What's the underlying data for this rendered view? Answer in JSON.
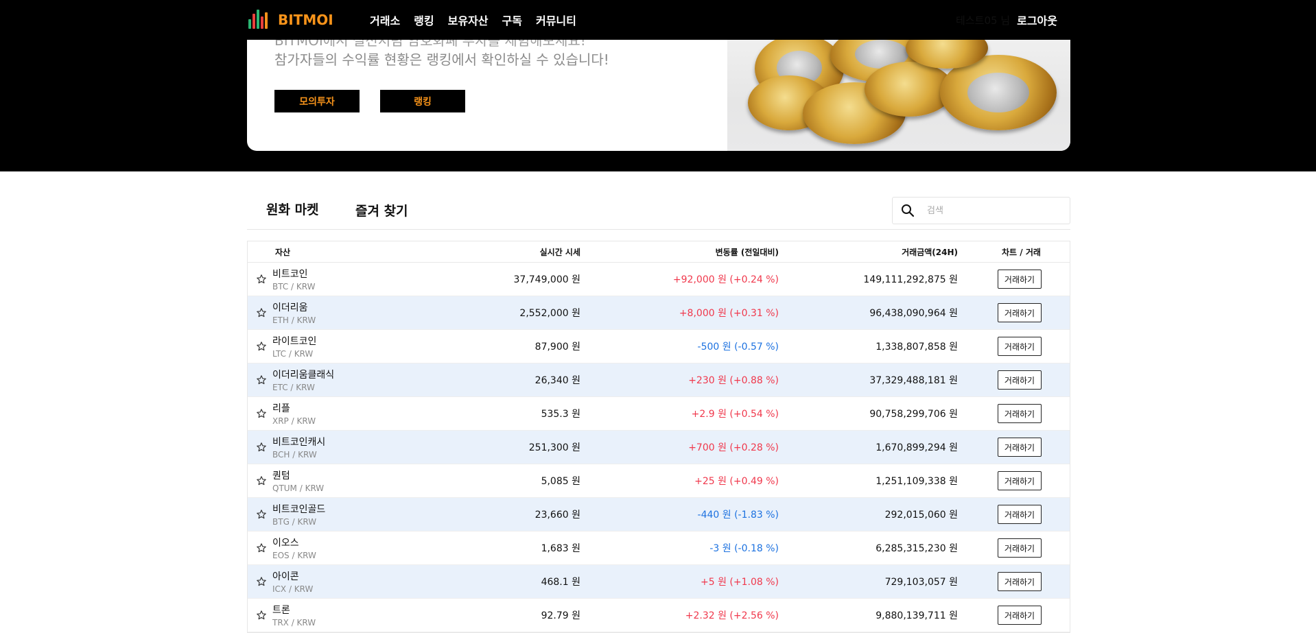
{
  "nav": {
    "logo_text": "BITMOI",
    "menu": [
      "거래소",
      "랭킹",
      "보유자산",
      "구독",
      "커뮤니티"
    ],
    "user_name": "테스트05 님",
    "logout_label": "로그아웃"
  },
  "hero": {
    "line1": "BITMOI에서 실전처럼 암호화폐 투자를 체험해보세요!",
    "line2": "참가자들의 수익률 현황은 랭킹에서 확인하실 수 있습니다!",
    "btn_trade": "모의투자",
    "btn_ranking": "랭킹"
  },
  "market": {
    "tabs": [
      "원화 마켓",
      "즐겨 찾기"
    ],
    "search_placeholder": "검색",
    "headers": {
      "asset": "자산",
      "price": "실시간 시세",
      "change": "변동률 (전일대비)",
      "volume": "거래금액(24H)",
      "action": "차트 / 거래"
    },
    "trade_label": "거래하기",
    "rows": [
      {
        "name": "비트코인",
        "symbol": "BTC / KRW",
        "price": "37,749,000 원",
        "change": "+92,000 원 (+0.24 %)",
        "dir": "up",
        "volume": "149,111,292,875 원"
      },
      {
        "name": "이더리움",
        "symbol": "ETH / KRW",
        "price": "2,552,000 원",
        "change": "+8,000 원 (+0.31 %)",
        "dir": "up",
        "volume": "96,438,090,964 원"
      },
      {
        "name": "라이트코인",
        "symbol": "LTC / KRW",
        "price": "87,900 원",
        "change": "-500 원 (-0.57 %)",
        "dir": "down",
        "volume": "1,338,807,858 원"
      },
      {
        "name": "이더리움클래식",
        "symbol": "ETC / KRW",
        "price": "26,340 원",
        "change": "+230 원 (+0.88 %)",
        "dir": "up",
        "volume": "37,329,488,181 원"
      },
      {
        "name": "리플",
        "symbol": "XRP / KRW",
        "price": "535.3 원",
        "change": "+2.9 원 (+0.54 %)",
        "dir": "up",
        "volume": "90,758,299,706 원"
      },
      {
        "name": "비트코인캐시",
        "symbol": "BCH / KRW",
        "price": "251,300 원",
        "change": "+700 원 (+0.28 %)",
        "dir": "up",
        "volume": "1,670,899,294 원"
      },
      {
        "name": "퀀텀",
        "symbol": "QTUM / KRW",
        "price": "5,085 원",
        "change": "+25 원 (+0.49 %)",
        "dir": "up",
        "volume": "1,251,109,338 원"
      },
      {
        "name": "비트코인골드",
        "symbol": "BTG / KRW",
        "price": "23,660 원",
        "change": "-440 원 (-1.83 %)",
        "dir": "down",
        "volume": "292,015,060 원"
      },
      {
        "name": "이오스",
        "symbol": "EOS / KRW",
        "price": "1,683 원",
        "change": "-3 원 (-0.18 %)",
        "dir": "down",
        "volume": "6,285,315,230 원"
      },
      {
        "name": "아이콘",
        "symbol": "ICX / KRW",
        "price": "468.1 원",
        "change": "+5 원 (+1.08 %)",
        "dir": "up",
        "volume": "729,103,057 원"
      },
      {
        "name": "트론",
        "symbol": "TRX / KRW",
        "price": "92.79 원",
        "change": "+2.32 원 (+2.56 %)",
        "dir": "up",
        "volume": "9,880,139,711 원"
      }
    ]
  },
  "colors": {
    "brand": "#f7931a",
    "up": "#f0384c",
    "down": "#1d72e0",
    "row_alt": "#e9f1fb"
  },
  "icons": {
    "search": "search-icon",
    "star": "star-outline-icon",
    "logo": "candlestick-logo-icon"
  }
}
